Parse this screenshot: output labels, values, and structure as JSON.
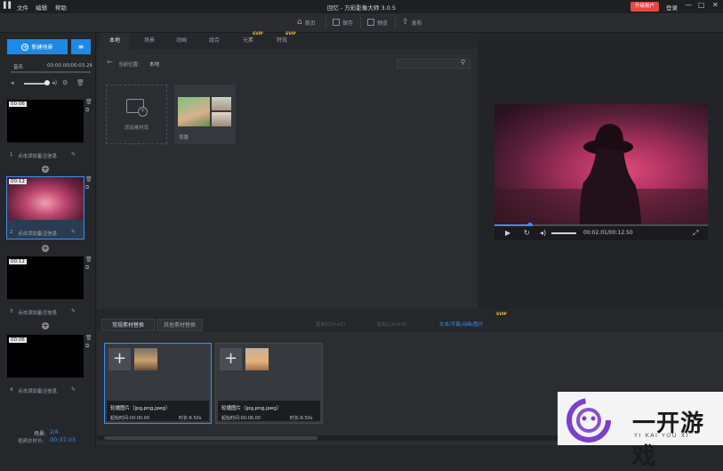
{
  "titlebar": {
    "menu": [
      "文件",
      "编辑",
      "帮助"
    ],
    "app_title": "回忆 - 万彩影像大师 3.0.5",
    "upgrade_label": "升级账户",
    "login_label": "登录"
  },
  "toolbar": {
    "home_label": "首页",
    "save_label": "保存",
    "preview_label": "预览",
    "publish_label": "发布"
  },
  "left_panel": {
    "new_scene_label": "新建场景",
    "music_label": "音乐",
    "music_time": "00:00.00/00:03.26",
    "scenes": [
      {
        "index": "1",
        "duration": "00:06",
        "label": "点击添加备注信息"
      },
      {
        "index": "2",
        "duration": "00:12",
        "label": "点击添加备注信息"
      },
      {
        "index": "3",
        "duration": "00:12",
        "label": "点击添加备注信息"
      },
      {
        "index": "4",
        "duration": "00:06",
        "label": "点击添加备注信息"
      }
    ],
    "scene_count_label": "场景:",
    "scene_count": "2/4",
    "total_time_label": "视频总时长:",
    "total_time": "00:37.03"
  },
  "material_panel": {
    "tabs": [
      "本地",
      "场景",
      "动画",
      "组合",
      "元素",
      "特效"
    ],
    "vip_badge": "SVIP",
    "path_label": "当前位置:",
    "path_value": "本地",
    "add_library_label": "添加素材库",
    "background_label": "背景"
  },
  "preview": {
    "time": "00:02.01/00:12.50",
    "progress_fraction": 0.16
  },
  "bottom_panel": {
    "tabs": [
      "常规素材替换",
      "其他素材替换"
    ],
    "disabled_actions": [
      "复制(Ctrl+C)",
      "粘贴(Ctrl+V)"
    ],
    "text_link": "文本/字幕/动画/图片",
    "cards": [
      {
        "title": "轮播图片（jpg,png,jpeg）",
        "start_label": "起始时间:00:00.00",
        "duration_label": "时长:6.50s"
      },
      {
        "title": "轮播图片（jpg,png,jpeg）",
        "start_label": "起始时间:00:06.00",
        "duration_label": "时长:6.50s"
      }
    ]
  },
  "watermark": {
    "text": "一开游戏",
    "pinyin": "YI KAI YOU XI"
  },
  "colors": {
    "accent": "#3b8ff0",
    "primary_button": "#1e88e5",
    "upgrade": "#e8473f"
  }
}
